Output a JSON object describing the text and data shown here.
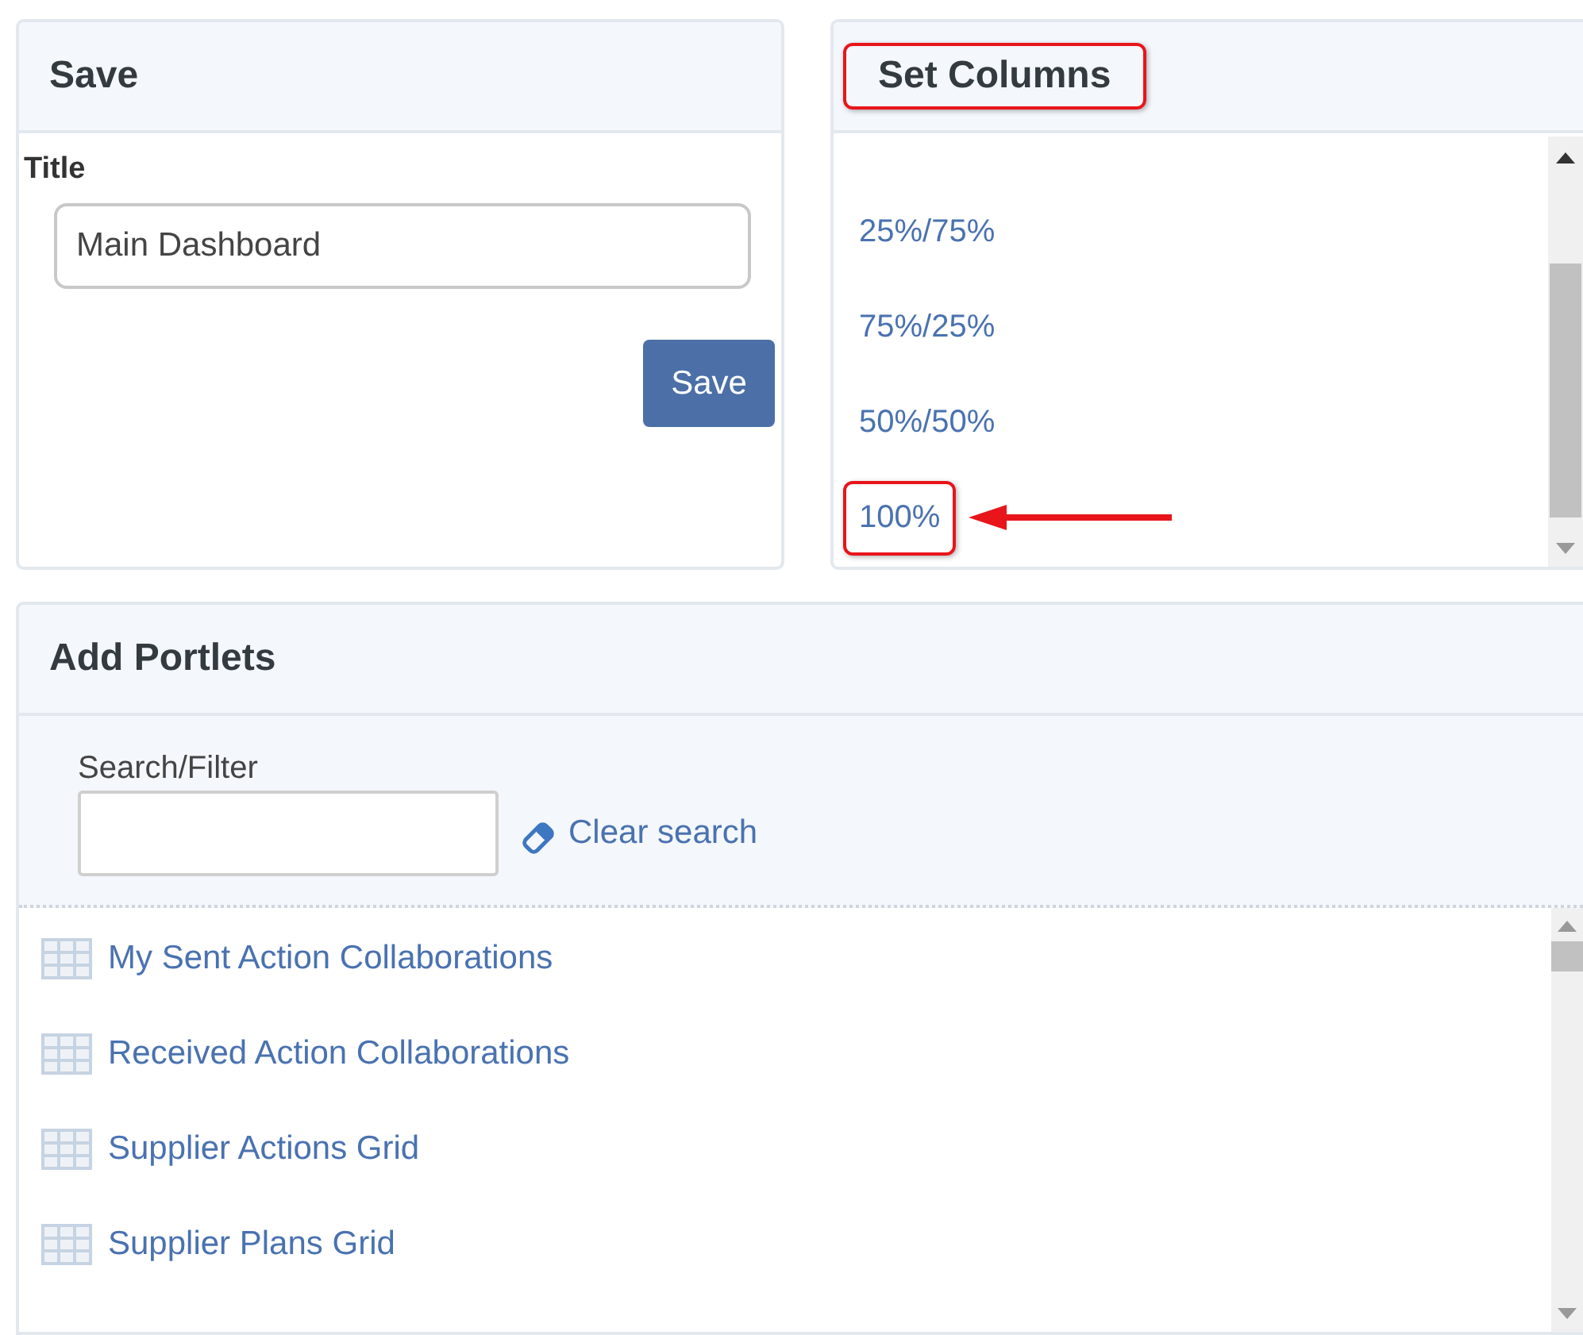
{
  "save_panel": {
    "title": "Save",
    "field_label": "Title",
    "field_value": "Main Dashboard",
    "button": "Save"
  },
  "set_columns": {
    "title": "Set Columns",
    "title_highlighted": true,
    "options": [
      {
        "label": "25%/75%",
        "highlighted": false
      },
      {
        "label": "75%/25%",
        "highlighted": false
      },
      {
        "label": "50%/50%",
        "highlighted": false
      },
      {
        "label": "100%",
        "highlighted": true
      }
    ]
  },
  "add_portlets": {
    "title": "Add Portlets",
    "search_label": "Search/Filter",
    "clear_link": "Clear search",
    "items": [
      {
        "label": "My Sent Action Collaborations"
      },
      {
        "label": "Received Action Collaborations"
      },
      {
        "label": "Supplier Actions Grid"
      },
      {
        "label": "Supplier Plans Grid"
      }
    ]
  }
}
